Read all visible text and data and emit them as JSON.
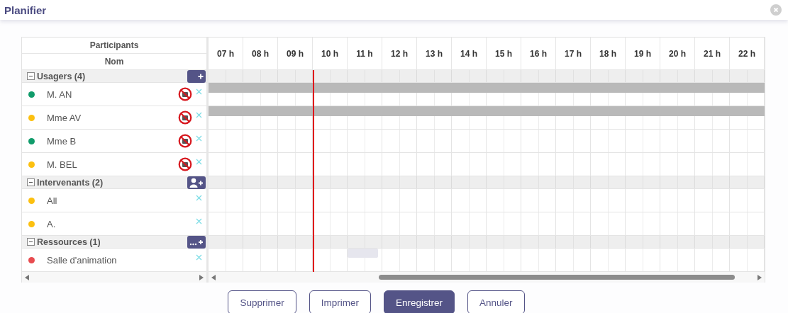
{
  "window": {
    "title": "Planifier"
  },
  "participants": {
    "heading": "Participants",
    "column": "Nom"
  },
  "hours": [
    {
      "label": "07 h",
      "current": false
    },
    {
      "label": "08 h",
      "current": false
    },
    {
      "label": "09 h",
      "current": false
    },
    {
      "label": "10 h",
      "current": true
    },
    {
      "label": "11 h",
      "current": false
    },
    {
      "label": "12 h",
      "current": false
    },
    {
      "label": "13 h",
      "current": false
    },
    {
      "label": "14 h",
      "current": false
    },
    {
      "label": "15 h",
      "current": false
    },
    {
      "label": "16 h",
      "current": false
    },
    {
      "label": "17 h",
      "current": false
    },
    {
      "label": "18 h",
      "current": false
    },
    {
      "label": "19 h",
      "current": false
    },
    {
      "label": "20 h",
      "current": false
    },
    {
      "label": "21 h",
      "current": false
    },
    {
      "label": "22 h",
      "current": false
    }
  ],
  "groups": [
    {
      "label": "Usagers (4)",
      "expanded": true,
      "add_button": {
        "kind": "plus"
      },
      "items": [
        {
          "name": "M. AN",
          "color": "#119c6b",
          "no_photo": true,
          "booking": {
            "kind": "full"
          }
        },
        {
          "name": "Mme AV",
          "color": "#fcc010",
          "no_photo": true,
          "booking": {
            "kind": "full"
          }
        },
        {
          "name": "Mme B",
          "color": "#119c6b",
          "no_photo": true
        },
        {
          "name": "M. BEL",
          "color": "#fcc010",
          "no_photo": true
        }
      ]
    },
    {
      "label": "Intervenants (2)",
      "expanded": true,
      "add_button": {
        "kind": "person"
      },
      "items": [
        {
          "name": "All",
          "color": "#fcc010",
          "no_photo": false
        },
        {
          "name": "A.",
          "color": "#fcc010",
          "no_photo": false
        }
      ]
    },
    {
      "label": "Ressources (1)",
      "expanded": true,
      "add_button": {
        "kind": "more"
      },
      "items": [
        {
          "name": "Salle d'animation",
          "color": "#e84c50",
          "no_photo": false,
          "booking": {
            "kind": "short"
          }
        }
      ]
    }
  ],
  "buttons": [
    {
      "label": "Supprimer",
      "primary": false
    },
    {
      "label": "Imprimer",
      "primary": false
    },
    {
      "label": "Enregistrer",
      "primary": true
    },
    {
      "label": "Annuler",
      "primary": false
    }
  ]
}
